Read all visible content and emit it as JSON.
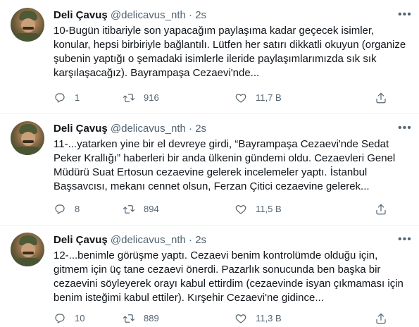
{
  "tweets": [
    {
      "author": "Deli Çavuş",
      "handle": "@delicavus_nth",
      "separator": "·",
      "time": "2s",
      "lines": [
        "10-Bugün itibariyle son yapacağım paylaşıma kadar geçecek isimler,",
        "konular, hepsi birbiriyle bağlantılı. Lütfen her satırı dikkatli okuyun (organize",
        "şubenin yaptığı o şemadaki isimlerle ileride paylaşımlarımızda sık sık",
        "karşılaşacağız). Bayrampaşa Cezaevi'nde..."
      ],
      "replies": "1",
      "retweets": "916",
      "likes": "11,7 B"
    },
    {
      "author": "Deli Çavuş",
      "handle": "@delicavus_nth",
      "separator": "·",
      "time": "2s",
      "lines": [
        "11-...yatarken yine bir el devreye girdi, “Bayrampaşa Cezaevi'nde Sedat",
        "Peker Krallığı” haberleri bir anda ülkenin gündemi oldu. Cezaevleri Genel",
        "Müdürü Suat Ertosun cezaevine gelerek incelemeler yaptı. İstanbul",
        "Başsavcısı, mekanı cennet olsun, Ferzan Çitici cezaevine gelerek..."
      ],
      "replies": "8",
      "retweets": "894",
      "likes": "11,5 B"
    },
    {
      "author": "Deli Çavuş",
      "handle": "@delicavus_nth",
      "separator": "·",
      "time": "2s",
      "lines": [
        "12-...benimle görüşme yaptı. Cezaevi benim kontrolümde olduğu için,",
        "gitmem için üç tane cezaevi önerdi. Pazarlık sonucunda ben başka bir",
        "cezaevini söyleyerek orayı kabul ettirdim (cezaevinde isyan çıkmaması için",
        "benim isteğimi kabul ettiler). Kırşehir Cezaevi'ne gidince..."
      ],
      "replies": "10",
      "retweets": "889",
      "likes": "11,3 B"
    }
  ],
  "icons": {
    "more": "more-horizontal-icon",
    "reply": "reply-icon",
    "retweet": "retweet-icon",
    "like": "heart-icon",
    "share": "share-icon"
  },
  "colors": {
    "text": "#0f1419",
    "secondary": "#536471",
    "divider": "#eff3f4"
  }
}
